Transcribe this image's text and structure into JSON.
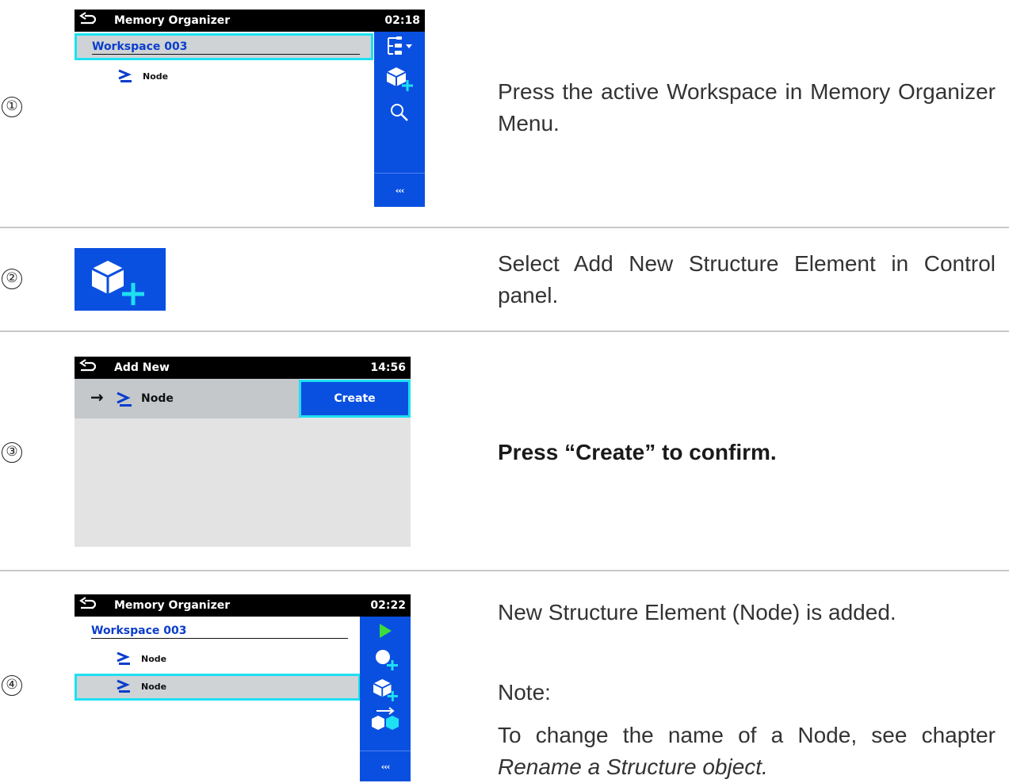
{
  "steps": [
    {
      "number": "①",
      "screen": {
        "title": "Memory Organizer",
        "time": "02:18",
        "workspace": "Workspace 003",
        "nodes": [
          "Node"
        ],
        "panel_icons": [
          "tree-menu-icon",
          "add-structure-element-icon",
          "search-icon",
          "more-icon"
        ],
        "more_label": "‹‹‹"
      },
      "description": "Press the active Workspace in Memory Organizer Menu."
    },
    {
      "number": "②",
      "icon": "add-structure-element-icon",
      "description": "Select Add New Structure Element in Control panel."
    },
    {
      "number": "③",
      "screen": {
        "title": "Add New",
        "time": "14:56",
        "item_arrow": "→",
        "item_label": "Node",
        "create_label": "Create"
      },
      "description": "Press “Create” to confirm."
    },
    {
      "number": "④",
      "screen": {
        "title": "Memory Organizer",
        "time": "02:22",
        "workspace": "Workspace 003",
        "nodes": [
          "Node",
          "Node"
        ],
        "panel_icons": [
          "play-icon",
          "add-measurement-icon",
          "add-structure-element-icon",
          "move-structure-icon",
          "more-icon"
        ],
        "more_label": "‹‹‹"
      },
      "description": "New Structure Element (Node) is added.",
      "note_label": "Note:",
      "note_text": "To change the name of a Node, see chapter",
      "note_link": "Rename a Structure object."
    }
  ],
  "colors": {
    "panel_blue": "#0a50e0",
    "selection_cyan": "#1ee0f2",
    "workspace_blue": "#0a3dcc",
    "play_green": "#3bdc3b"
  }
}
